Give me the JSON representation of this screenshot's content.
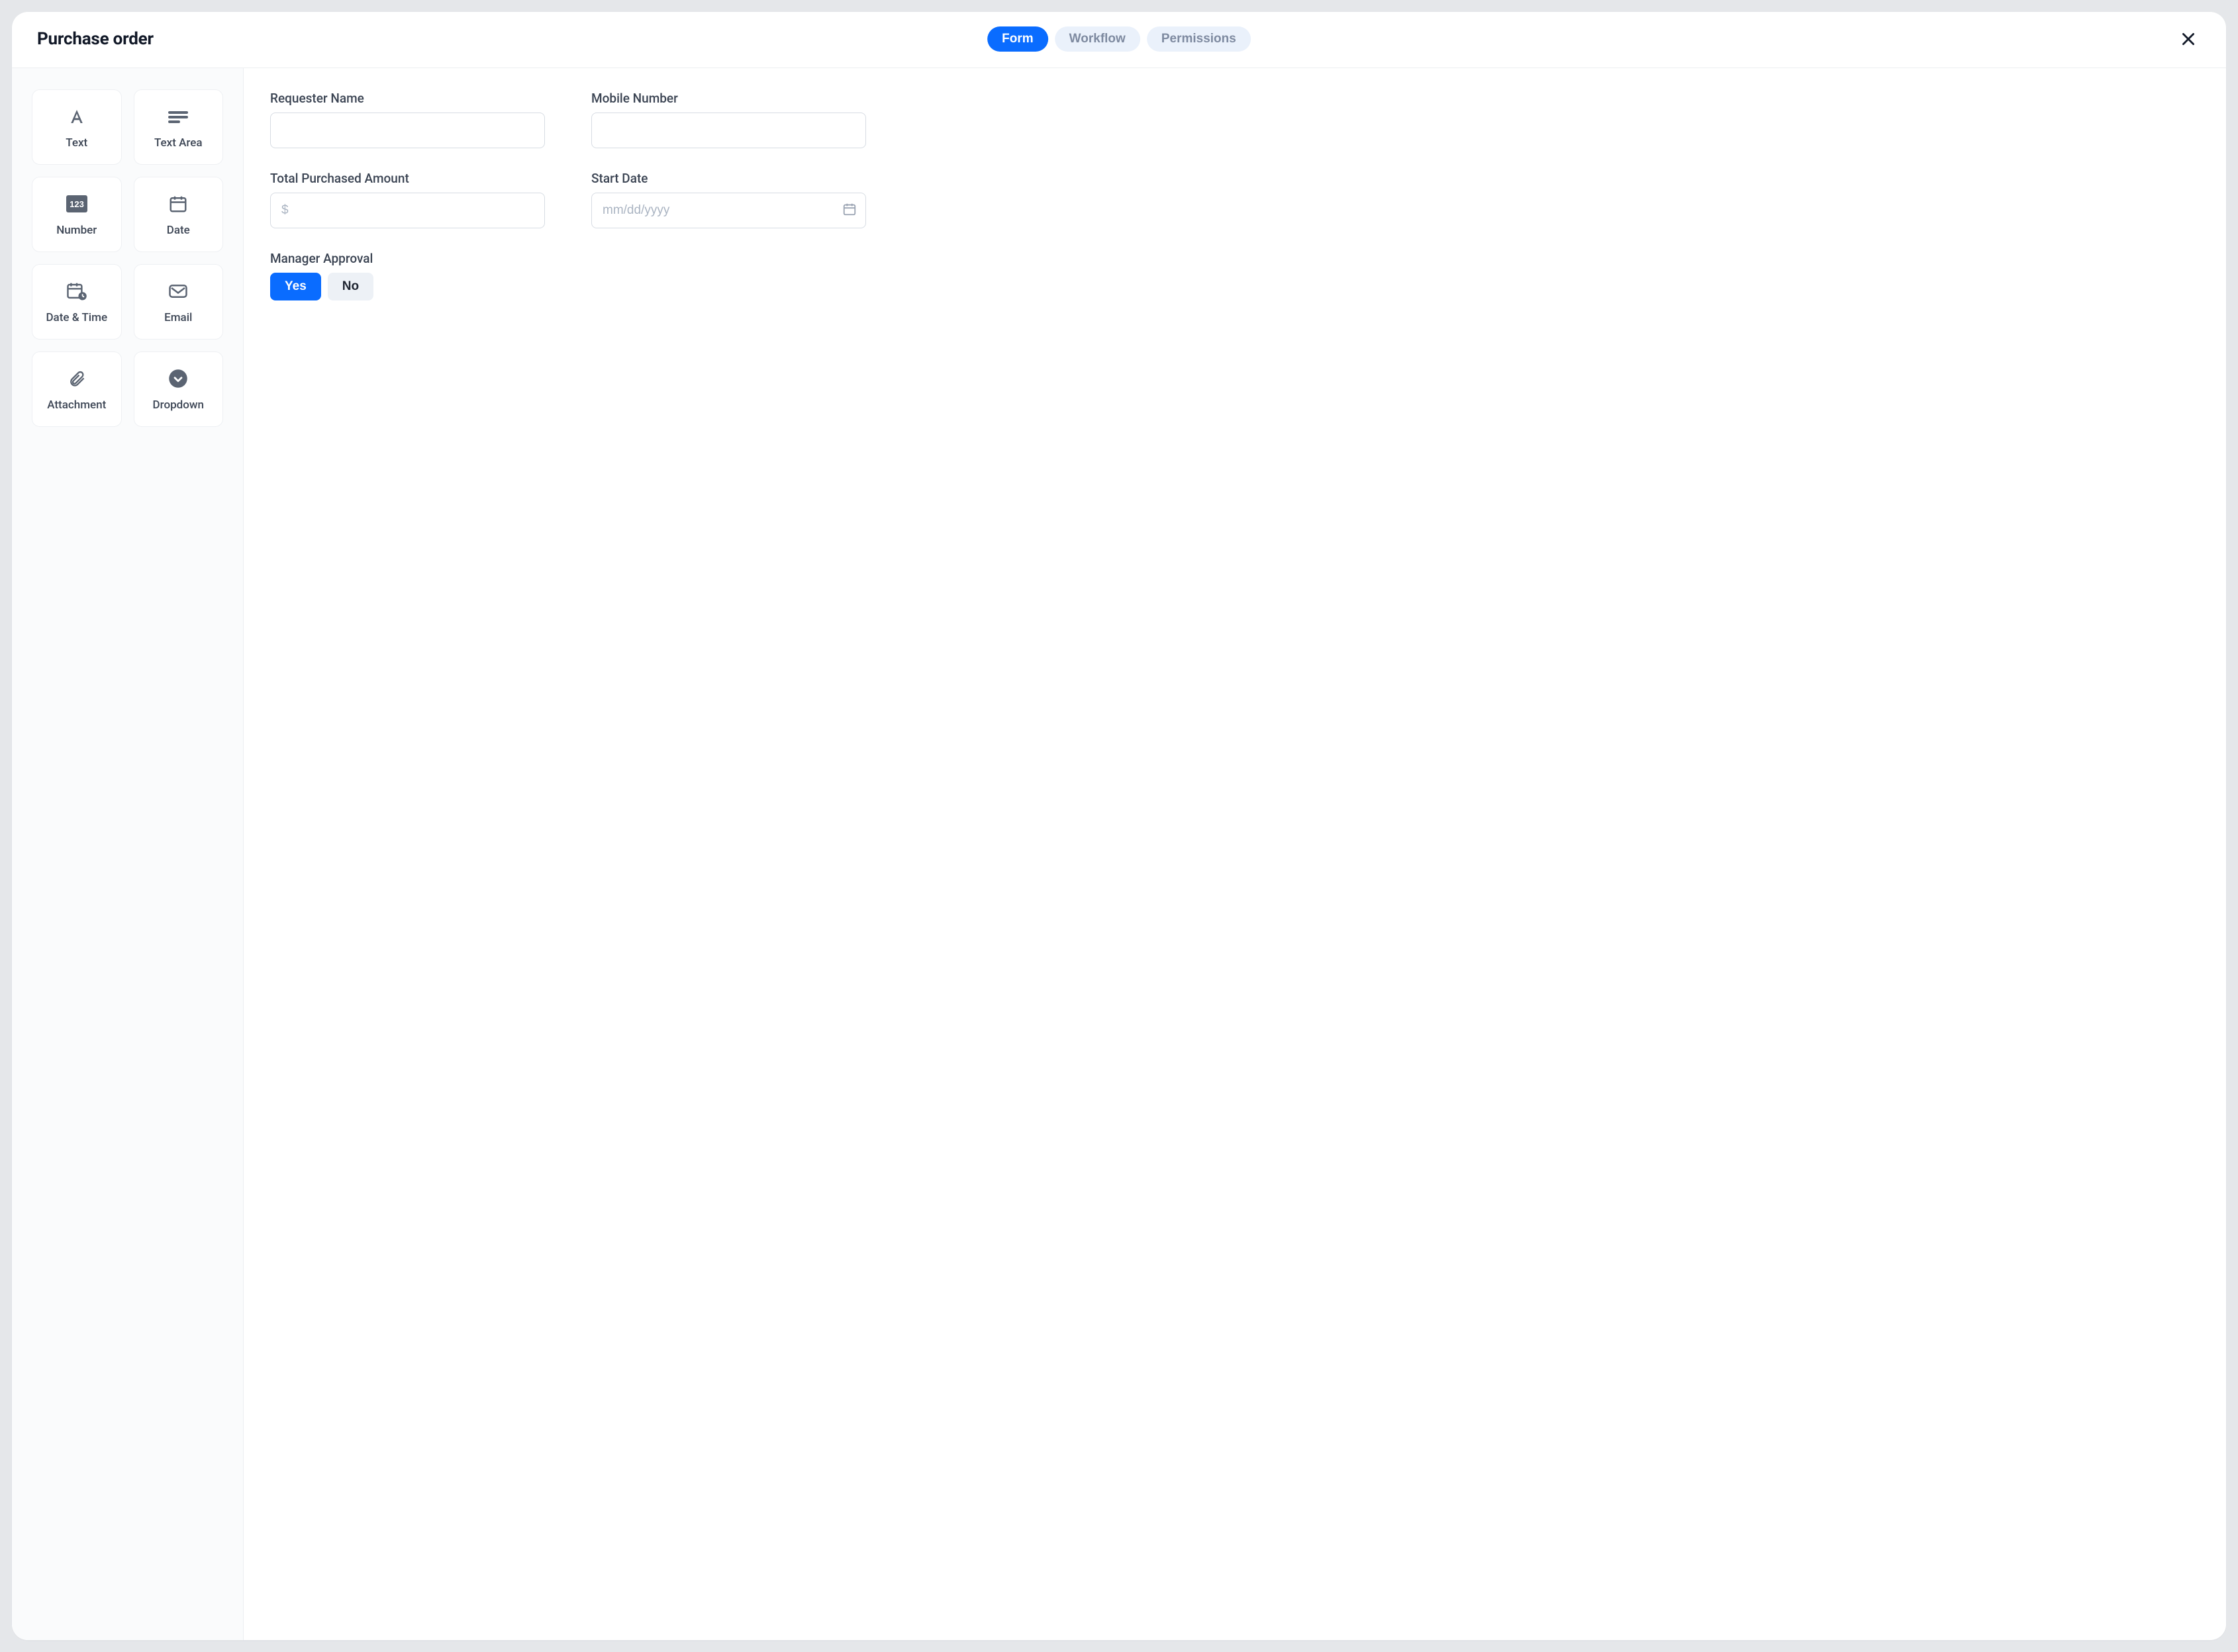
{
  "header": {
    "title": "Purchase order",
    "tabs": [
      {
        "label": "Form",
        "active": true
      },
      {
        "label": "Workflow",
        "active": false
      },
      {
        "label": "Permissions",
        "active": false
      }
    ]
  },
  "palette": {
    "items": [
      {
        "label": "Text"
      },
      {
        "label": "Text Area"
      },
      {
        "label": "Number"
      },
      {
        "label": "Date"
      },
      {
        "label": "Date & Time"
      },
      {
        "label": "Email"
      },
      {
        "label": "Attachment"
      },
      {
        "label": "Dropdown"
      }
    ]
  },
  "form": {
    "requesterName": {
      "label": "Requester Name",
      "value": ""
    },
    "mobileNumber": {
      "label": "Mobile Number",
      "value": ""
    },
    "totalAmount": {
      "label": "Total Purchased Amount",
      "placeholder": "$",
      "value": ""
    },
    "startDate": {
      "label": "Start Date",
      "placeholder": "mm/dd/yyyy",
      "value": ""
    },
    "managerApproval": {
      "label": "Manager Approval",
      "yesLabel": "Yes",
      "noLabel": "No",
      "value": "Yes"
    }
  }
}
